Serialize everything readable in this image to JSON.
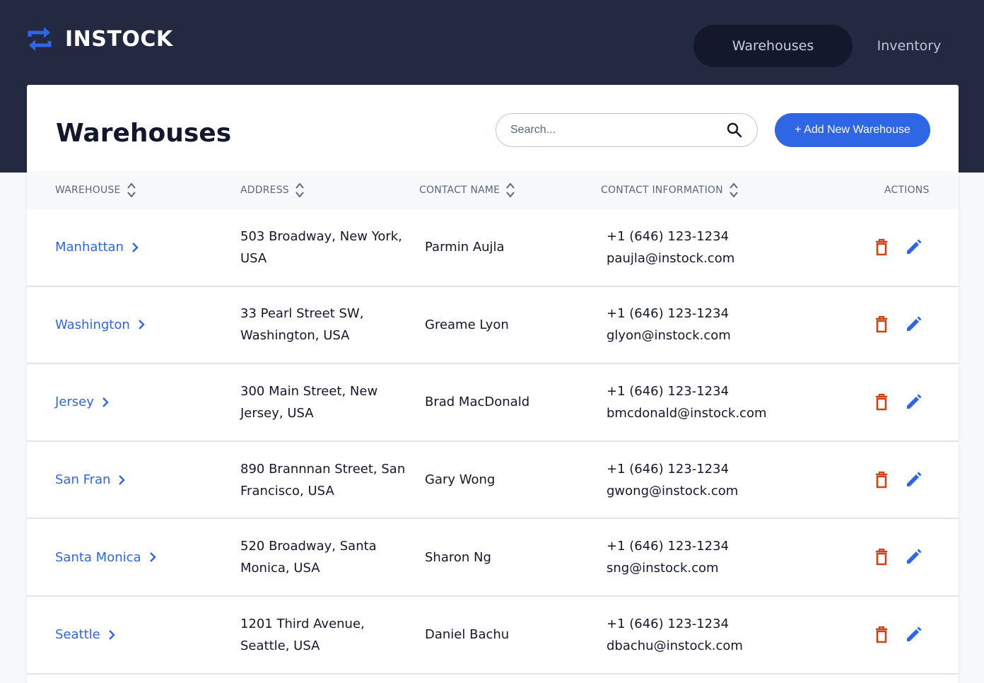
{
  "app": {
    "name": "INSTOCK"
  },
  "nav": {
    "items": [
      {
        "label": "Warehouses",
        "active": true
      },
      {
        "label": "Inventory",
        "active": false
      }
    ]
  },
  "page": {
    "title": "Warehouses",
    "search_placeholder": "Search...",
    "add_button": "+ Add New Warehouse"
  },
  "table": {
    "columns": [
      "WAREHOUSE",
      "ADDRESS",
      "CONTACT NAME",
      "CONTACT INFORMATION",
      "ACTIONS"
    ],
    "rows": [
      {
        "warehouse": "Manhattan",
        "address": "503 Broadway, New York, USA",
        "contact": "Parmin Aujla",
        "phone": "+1 (646) 123-1234",
        "email": "paujla@instock.com"
      },
      {
        "warehouse": "Washington",
        "address": "33 Pearl Street SW, Washington, USA",
        "contact": "Greame Lyon",
        "phone": "+1 (646) 123-1234",
        "email": "glyon@instock.com"
      },
      {
        "warehouse": "Jersey",
        "address": "300 Main Street, New Jersey, USA",
        "contact": "Brad MacDonald",
        "phone": "+1 (646) 123-1234",
        "email": "bmcdonald@instock.com"
      },
      {
        "warehouse": "San Fran",
        "address": "890 Brannnan Street, San Francisco, USA",
        "contact": "Gary Wong",
        "phone": "+1 (646) 123-1234",
        "email": "gwong@instock.com"
      },
      {
        "warehouse": "Santa Monica",
        "address": "520 Broadway, Santa Monica, USA",
        "contact": "Sharon Ng",
        "phone": "+1 (646) 123-1234",
        "email": "sng@instock.com"
      },
      {
        "warehouse": "Seattle",
        "address": "1201 Third Avenue, Seattle, USA",
        "contact": "Daniel Bachu",
        "phone": "+1 (646) 123-1234",
        "email": "dbachu@instock.com"
      }
    ]
  },
  "icons": {
    "logo": "swap-arrows-icon",
    "search": "search-icon",
    "sort": "sort-icon",
    "chevron": "chevron-right-icon",
    "delete": "delete-icon",
    "edit": "edit-icon"
  },
  "colors": {
    "header_bg": "#232940",
    "nav_active_bg": "#13182c",
    "accent_blue": "#2e66e6",
    "delete_red": "#c94515",
    "text_dark": "#13182c",
    "text_muted": "#5c667e",
    "divider": "#dfe3eb",
    "table_head_bg": "#f7f8fa"
  }
}
